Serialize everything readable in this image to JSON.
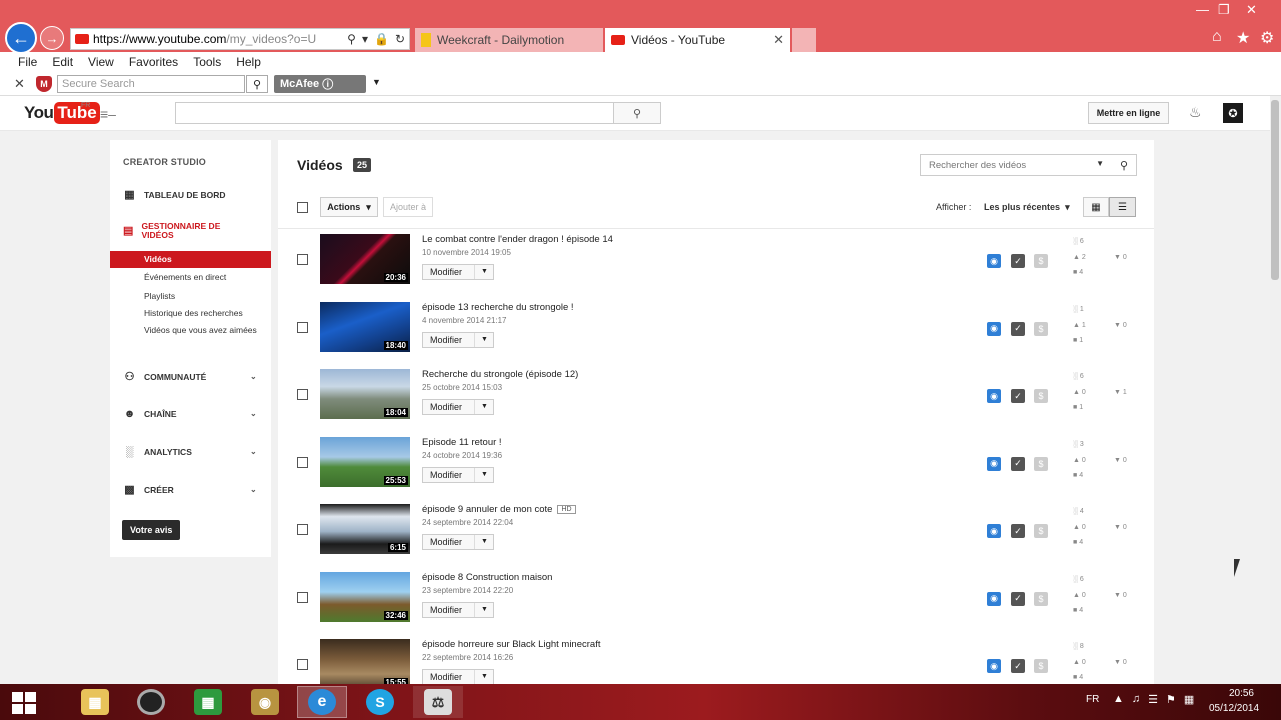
{
  "browser": {
    "url_main": "https://www.youtube.com",
    "url_rest": "/my_videos?o=U",
    "tabs": [
      {
        "label": "Weekcraft - Dailymotion"
      },
      {
        "label": "Vidéos - YouTube"
      }
    ],
    "menu": [
      "File",
      "Edit",
      "View",
      "Favorites",
      "Tools",
      "Help"
    ],
    "secure_search_placeholder": "Secure Search",
    "mcafee_label": "McAfee",
    "accent_color": "#e3595b"
  },
  "youtube": {
    "logo_you": "You",
    "logo_tube": "Tube",
    "region": "FR",
    "upload_label": "Mettre en ligne",
    "brand_color": "#e62117"
  },
  "sidebar": {
    "title": "CREATOR STUDIO",
    "dashboard": "TABLEAU DE BORD",
    "video_manager": "GESTIONNAIRE DE VIDÉOS",
    "items": {
      "videos": "Vidéos",
      "live": "Événements en direct",
      "playlists": "Playlists",
      "search_history": "Historique des recherches",
      "watched": "Vidéos que vous avez aimées"
    },
    "community": "COMMUNAUTÉ",
    "channel": "CHAÎNE",
    "analytics": "ANALYTICS",
    "create": "CRÉER",
    "feedback": "Votre avis"
  },
  "main": {
    "title": "Vidéos",
    "count": "25",
    "search_placeholder": "Rechercher des vidéos",
    "actions_label": "Actions",
    "add_to_label": "Ajouter à",
    "show_label": "Afficher :",
    "sort_label": "Les plus récentes",
    "edit_label": "Modifier",
    "hd_label": "HD",
    "videos": [
      {
        "title": "Le combat contre l'ender dragon ! épisode 14",
        "date": "10 novembre 2014 19:05",
        "duration": "20:36",
        "views": "6",
        "likes": "2",
        "comments": "4",
        "dislikes": "0",
        "hd": false
      },
      {
        "title": "épisode 13 recherche du strongole !",
        "date": "4 novembre 2014 21:17",
        "duration": "18:40",
        "views": "1",
        "likes": "1",
        "comments": "1",
        "dislikes": "0",
        "hd": false
      },
      {
        "title": "Recherche du strongole (épisode 12)",
        "date": "25 octobre 2014 15:03",
        "duration": "18:04",
        "views": "6",
        "likes": "0",
        "comments": "1",
        "dislikes": "1",
        "hd": false
      },
      {
        "title": "Episode 11 retour !",
        "date": "24 octobre 2014 19:36",
        "duration": "25:53",
        "views": "3",
        "likes": "0",
        "comments": "4",
        "dislikes": "0",
        "hd": false
      },
      {
        "title": "épisode 9 annuler de mon cote",
        "date": "24 septembre 2014 22:04",
        "duration": "6:15",
        "views": "4",
        "likes": "0",
        "comments": "4",
        "dislikes": "0",
        "hd": true
      },
      {
        "title": "épisode 8 Construction maison",
        "date": "23 septembre 2014 22:20",
        "duration": "32:46",
        "views": "6",
        "likes": "0",
        "comments": "4",
        "dislikes": "0",
        "hd": false
      },
      {
        "title": "épisode horreure sur Black Light minecraft",
        "date": "22 septembre 2014 16:26",
        "duration": "15:55",
        "views": "8",
        "likes": "0",
        "comments": "4",
        "dislikes": "0",
        "hd": false
      }
    ]
  },
  "taskbar": {
    "lang": "FR",
    "time": "20:56",
    "date": "05/12/2014"
  }
}
